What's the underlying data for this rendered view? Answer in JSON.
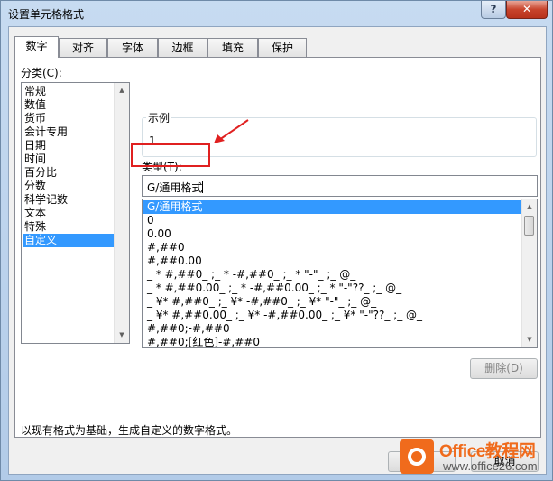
{
  "dialog": {
    "title": "设置单元格格式",
    "help_label": "?",
    "close_label": "✕"
  },
  "tabs": [
    {
      "label": "数字",
      "active": true
    },
    {
      "label": "对齐"
    },
    {
      "label": "字体"
    },
    {
      "label": "边框"
    },
    {
      "label": "填充"
    },
    {
      "label": "保护"
    }
  ],
  "category": {
    "label": "分类(C):",
    "items": [
      "常规",
      "数值",
      "货币",
      "会计专用",
      "日期",
      "时间",
      "百分比",
      "分数",
      "科学记数",
      "文本",
      "特殊",
      "自定义"
    ],
    "selected": "自定义"
  },
  "sample": {
    "legend": "示例",
    "value": "1"
  },
  "type_field": {
    "label": "类型(T):",
    "value": "G/通用格式"
  },
  "format_list": {
    "items": [
      "G/通用格式",
      "0",
      "0.00",
      "#,##0",
      "#,##0.00",
      "_ * #,##0_ ;_ * -#,##0_ ;_ * \"-\"_ ;_ @_",
      "_ * #,##0.00_ ;_ * -#,##0.00_ ;_ * \"-\"??_ ;_ @_",
      "_ ¥* #,##0_ ;_ ¥* -#,##0_ ;_ ¥* \"-\"_ ;_ @_",
      "_ ¥* #,##0.00_ ;_ ¥* -#,##0.00_ ;_ ¥* \"-\"??_ ;_ @_",
      "#,##0;-#,##0",
      "#,##0;[红色]-#,##0"
    ],
    "selected": "G/通用格式"
  },
  "buttons": {
    "delete": "删除(D)",
    "ok": "确定",
    "cancel": "取消"
  },
  "description": "以现有格式为基础，生成自定义的数字格式。",
  "watermark": {
    "title": "Office教程网",
    "url": "www.office26.com"
  },
  "colors": {
    "selection": "#3399ff",
    "annotation": "#e02020",
    "brand": "#f06b1c"
  }
}
